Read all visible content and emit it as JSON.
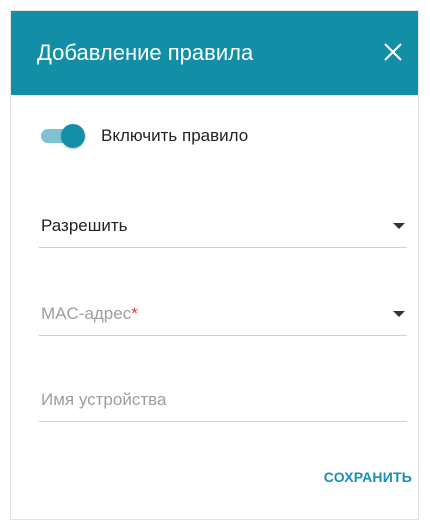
{
  "dialog": {
    "title": "Добавление правила",
    "close_icon": "close-icon",
    "header_color": "#128ea6"
  },
  "toggle": {
    "label": "Включить правило",
    "enabled": true,
    "accent_color": "#148fa8"
  },
  "action_select": {
    "value": "Разрешить"
  },
  "mac_select": {
    "placeholder": "MAC-адрес",
    "required_mark": "*"
  },
  "device_name": {
    "placeholder": "Имя устройства"
  },
  "footer": {
    "save_label": "СОХРАНИТЬ",
    "save_color": "#1a8fb3"
  }
}
